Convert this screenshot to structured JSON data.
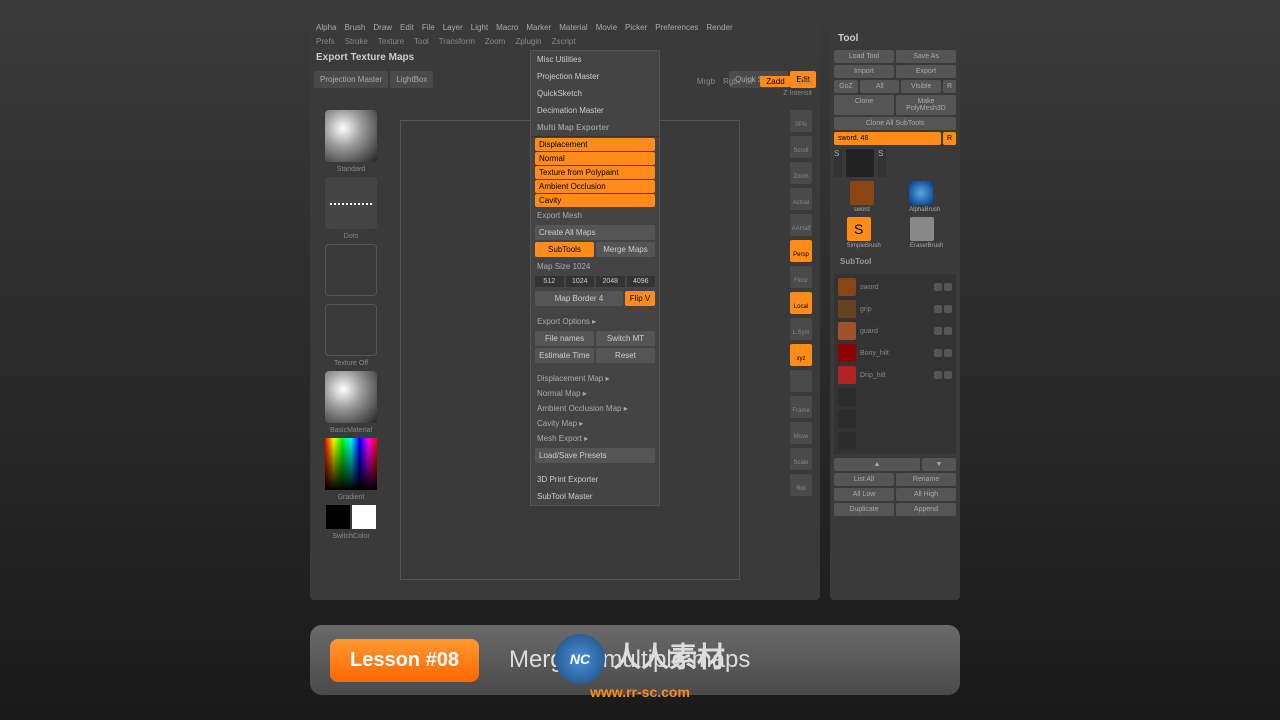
{
  "menubar": [
    "Alpha",
    "Brush",
    "...",
    "Draw",
    "Edit",
    "File",
    "Layer",
    "Light",
    "Macro",
    "Marker",
    "Material",
    "Movie",
    "Picker",
    "Preferences",
    "Render"
  ],
  "submenu": [
    "Prefs",
    "Stroke",
    "Texture",
    "Tool",
    "Transform",
    "Zoom",
    "Zplugin",
    "Zscript"
  ],
  "titlebar": "Export Texture Maps",
  "toolbar": {
    "projection": "Projection\nMaster",
    "lightbox": "LightBox",
    "quicksketch": "Quick\nSketch",
    "edit": "Edit"
  },
  "toprow": {
    "mrgb": "Mrgb",
    "rgb": "Rgb",
    "m": "M",
    "zadd": "Zadd",
    "zsub": "Zsu",
    "zint": "Z Intensit"
  },
  "leftlabels": {
    "standard": "Standard",
    "dots": "Dots",
    "off": "Texture Off",
    "material": "BasicMaterial",
    "gradient": "Gradient",
    "switch": "SwitchColor"
  },
  "dropdown": {
    "misc": "Misc Utilities",
    "proj": "Projection Master",
    "qs": "QuickSketch",
    "dec": "Decimation Master",
    "mme": "Multi Map Exporter",
    "opts": [
      "Displacement",
      "Normal",
      "Texture from Polypaint",
      "Ambient Occlusion",
      "Cavity"
    ],
    "export": "Export Mesh",
    "createall": "Create All Maps",
    "subtools": "SubTools",
    "merge": "Merge Maps",
    "mapsize": "Map Size 1024",
    "sizes": [
      "512",
      "1024",
      "2048",
      "4096"
    ],
    "border": "Map Border 4",
    "flipv": "Flip V",
    "expopt": "Export Options  ▸",
    "filenames": "File names",
    "switchmt": "Switch MT",
    "estimate": "Estimate Time",
    "reset": "Reset",
    "maps": [
      "Displacement Map  ▸",
      "Normal Map  ▸",
      "Ambient Occlusion Map  ▸",
      "Cavity Map  ▸",
      "Mesh Export  ▸"
    ],
    "loadsave": "Load/Save Presets",
    "print3d": "3D Print Exporter",
    "stmaster": "SubTool Master"
  },
  "ricons": [
    "SPix",
    "Scroll",
    "Zoom",
    "Actual",
    "AAHalf",
    "Persp",
    "Floor",
    "Local",
    "L.Sym",
    "xyz",
    "",
    "Frame",
    "Move",
    "Scale",
    "Rot"
  ],
  "ricons_orange": [
    5,
    7,
    9
  ],
  "tool": {
    "title": "Tool",
    "load": "Load Tool",
    "save": "Save As",
    "import": "Import",
    "export": "Export",
    "goz": "GoZ",
    "all": "All",
    "visible": "Visible",
    "r": "R",
    "clone": "Clone",
    "poly": "Make PolyMesh3D",
    "cloneall": "Clone All SubTools",
    "name": "sword. 48",
    "r2": "R",
    "items": [
      "sword",
      "AlphaBrush",
      "SimpleBrush",
      "EraserBrush"
    ],
    "subtool": "SubTool",
    "stlist": [
      "sword",
      "grip",
      "guard",
      "Bony_hilt",
      "Drip_hilt",
      "",
      "",
      ""
    ],
    "listall": "List All",
    "rename": "Rename",
    "alllow": "All Low",
    "allhigh": "All High",
    "dup": "Duplicate",
    "append": "Append"
  },
  "banner": {
    "lesson": "Lesson #08",
    "title": "Merging multiple maps"
  },
  "watermark": {
    "text": "人人素材",
    "url": "www.rr-sc.com"
  }
}
